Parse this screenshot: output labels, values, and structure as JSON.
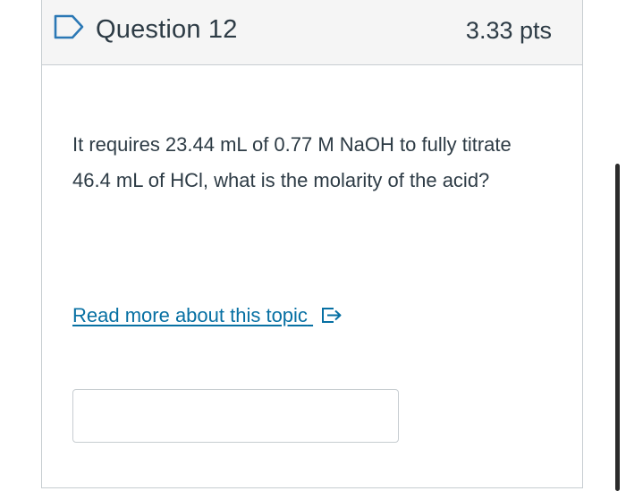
{
  "header": {
    "title": "Question 12",
    "points": "3.33 pts",
    "flag_icon": "bookmark-flag-icon"
  },
  "question": {
    "text": "It requires 23.44 mL of 0.77 M NaOH to fully titrate 46.4 mL of HCl, what is the molarity of the acid?"
  },
  "read_more": {
    "label": "Read more about this topic",
    "icon": "external-link-icon"
  },
  "answer": {
    "value": "",
    "placeholder": ""
  },
  "colors": {
    "text": "#2d3b45",
    "link": "#0770a3",
    "border": "#c7cdd1",
    "header_bg": "#f5f5f5",
    "flag": "#2b78b5"
  }
}
